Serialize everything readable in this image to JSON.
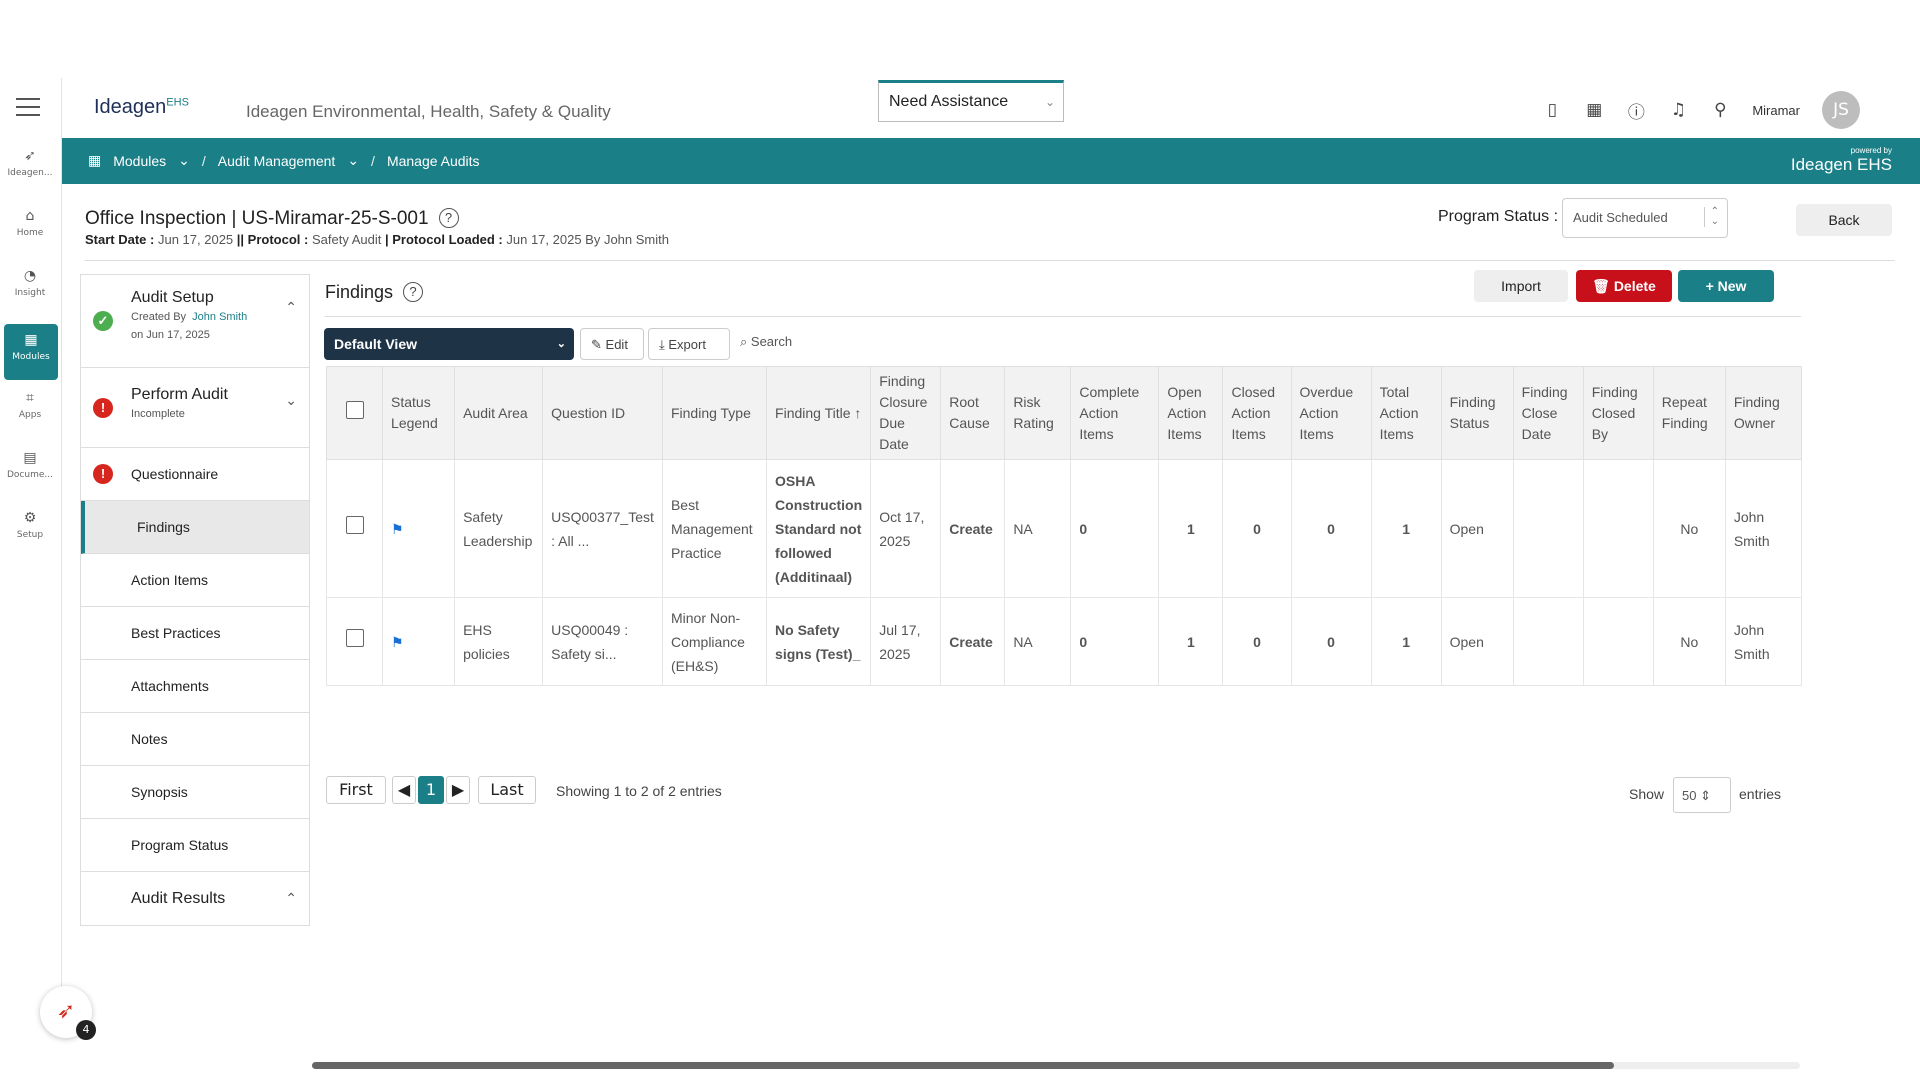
{
  "rail": {
    "items": [
      {
        "label": "Ideagen...",
        "icon": "ideagen-icon"
      },
      {
        "label": "Home",
        "icon": "home-icon"
      },
      {
        "label": "Insight",
        "icon": "insight-icon"
      },
      {
        "label": "Modules",
        "icon": "modules-icon"
      },
      {
        "label": "Apps",
        "icon": "apps-icon"
      },
      {
        "label": "Docume...",
        "icon": "document-icon"
      },
      {
        "label": "Setup",
        "icon": "setup-icon"
      }
    ]
  },
  "header": {
    "logo": "Ideagen",
    "logo_suffix": "EHS",
    "app_title": "Ideagen Environmental, Health, Safety & Quality",
    "assistance": "Need Assistance",
    "location": "Miramar",
    "avatar": "JS"
  },
  "breadcrumb": {
    "modules": "Modules",
    "audit_management": "Audit Management",
    "manage_audits": "Manage Audits",
    "powered_small": "powered by",
    "powered_brand": "Ideagen EHS"
  },
  "page": {
    "title": "Office Inspection | US-Miramar-25-S-001",
    "meta_start_label": "Start Date :",
    "meta_start": "Jun 17, 2025",
    "meta_protocol_label": "|| Protocol :",
    "meta_protocol": "Safety Audit",
    "meta_loaded_label": "| Protocol Loaded :",
    "meta_loaded": "Jun 17, 2025 By John Smith",
    "program_status_label": "Program Status :",
    "program_status_value": "Audit Scheduled",
    "back": "Back"
  },
  "sections": {
    "audit_setup": {
      "title": "Audit Setup",
      "created_by": "Created By",
      "creator": "John Smith",
      "date": "on Jun 17, 2025"
    },
    "perform_audit": {
      "title": "Perform Audit",
      "status": "Incomplete"
    },
    "questionnaire": "Questionnaire",
    "findings": "Findings",
    "action_items": "Action Items",
    "best_practices": "Best Practices",
    "attachments": "Attachments",
    "notes": "Notes",
    "synopsis": "Synopsis",
    "program_status": "Program Status",
    "audit_results": "Audit Results"
  },
  "findings": {
    "title": "Findings",
    "import": "Import",
    "delete": "Delete",
    "new": "New",
    "view": "Default View",
    "edit": "Edit",
    "export": "Export",
    "search": "Search"
  },
  "table": {
    "columns": [
      "Status Legend",
      "Audit Area",
      "Question ID",
      "Finding Type",
      "Finding Title",
      "Finding Closure Due Date",
      "Root Cause",
      "Risk Rating",
      "Complete Action Items",
      "Open Action Items",
      "Closed Action Items",
      "Overdue Action Items",
      "Total Action Items",
      "Finding Status",
      "Finding Close Date",
      "Finding Closed By",
      "Repeat Finding",
      "Finding Owner"
    ],
    "rows": [
      {
        "audit_area": "Safety Leadership",
        "question_id": "USQ00377_Test : All ...",
        "finding_type": "Best Management Practice",
        "finding_title": "OSHA Construction Standard not followed (Additinaal)",
        "due_date": "Oct 17, 2025",
        "root_cause": "Create",
        "risk_rating": "NA",
        "complete": "0",
        "open": "1",
        "closed": "0",
        "overdue": "0",
        "total": "1",
        "status": "Open",
        "close_date": "",
        "closed_by": "",
        "repeat": "No",
        "owner": "John Smith"
      },
      {
        "audit_area": "EHS policies",
        "question_id": "USQ00049 : Safety si...",
        "finding_type": "Minor Non-Compliance (EH&S)",
        "finding_title": "No Safety signs (Test)_",
        "due_date": "Jul 17, 2025",
        "root_cause": "Create",
        "risk_rating": "NA",
        "complete": "0",
        "open": "1",
        "closed": "0",
        "overdue": "0",
        "total": "1",
        "status": "Open",
        "close_date": "",
        "closed_by": "",
        "repeat": "No",
        "owner": "John Smith"
      }
    ]
  },
  "pagination": {
    "first": "First",
    "prev": "◀",
    "current": "1",
    "next": "▶",
    "last": "Last",
    "showing": "Showing 1 to 2 of 2 entries",
    "show": "Show",
    "page_size": "50",
    "entries": "entries"
  },
  "fab_badge": "4",
  "colors": {
    "accent": "#1a7f86",
    "danger": "#c8101a",
    "dark": "#1f3346"
  }
}
